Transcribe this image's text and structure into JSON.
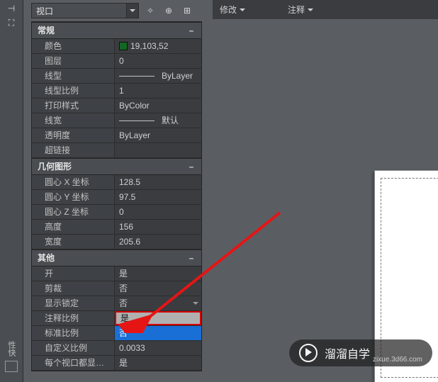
{
  "topbar": {
    "viewport_label": "视口",
    "ruler_modify": "修改",
    "ruler_annotate": "注释"
  },
  "sections": {
    "general": {
      "title": "常规",
      "color_label": "颜色",
      "color_value": "19,103,52",
      "layer_label": "图层",
      "layer_value": "0",
      "linetype_label": "线型",
      "linetype_value": "ByLayer",
      "ltscale_label": "线型比例",
      "ltscale_value": "1",
      "plotstyle_label": "打印样式",
      "plotstyle_value": "ByColor",
      "lineweight_label": "线宽",
      "lineweight_value": "默认",
      "transparency_label": "透明度",
      "transparency_value": "ByLayer",
      "hyperlink_label": "超链接",
      "hyperlink_value": ""
    },
    "geometry": {
      "title": "几何图形",
      "cx_label": "圆心 X 坐标",
      "cx_value": "128.5",
      "cy_label": "圆心 Y 坐标",
      "cy_value": "97.5",
      "cz_label": "圆心 Z 坐标",
      "cz_value": "0",
      "height_label": "高度",
      "height_value": "156",
      "width_label": "宽度",
      "width_value": "205.6"
    },
    "other": {
      "title": "其他",
      "on_label": "开",
      "on_value": "是",
      "clip_label": "剪裁",
      "clip_value": "否",
      "lock_label": "显示锁定",
      "lock_value": "否",
      "annoscale_label": "注释比例",
      "annoscale_value": "是",
      "stdscale_label": "标准比例",
      "stdscale_value": "否",
      "customscale_label": "自定义比例",
      "customscale_value": "0.0033",
      "pervp_label": "每个视口都显…",
      "pervp_value": "是"
    }
  },
  "sidebar_label": "性快",
  "watermark": {
    "name": "溜溜自学",
    "site": "zixue.3d66.com"
  }
}
